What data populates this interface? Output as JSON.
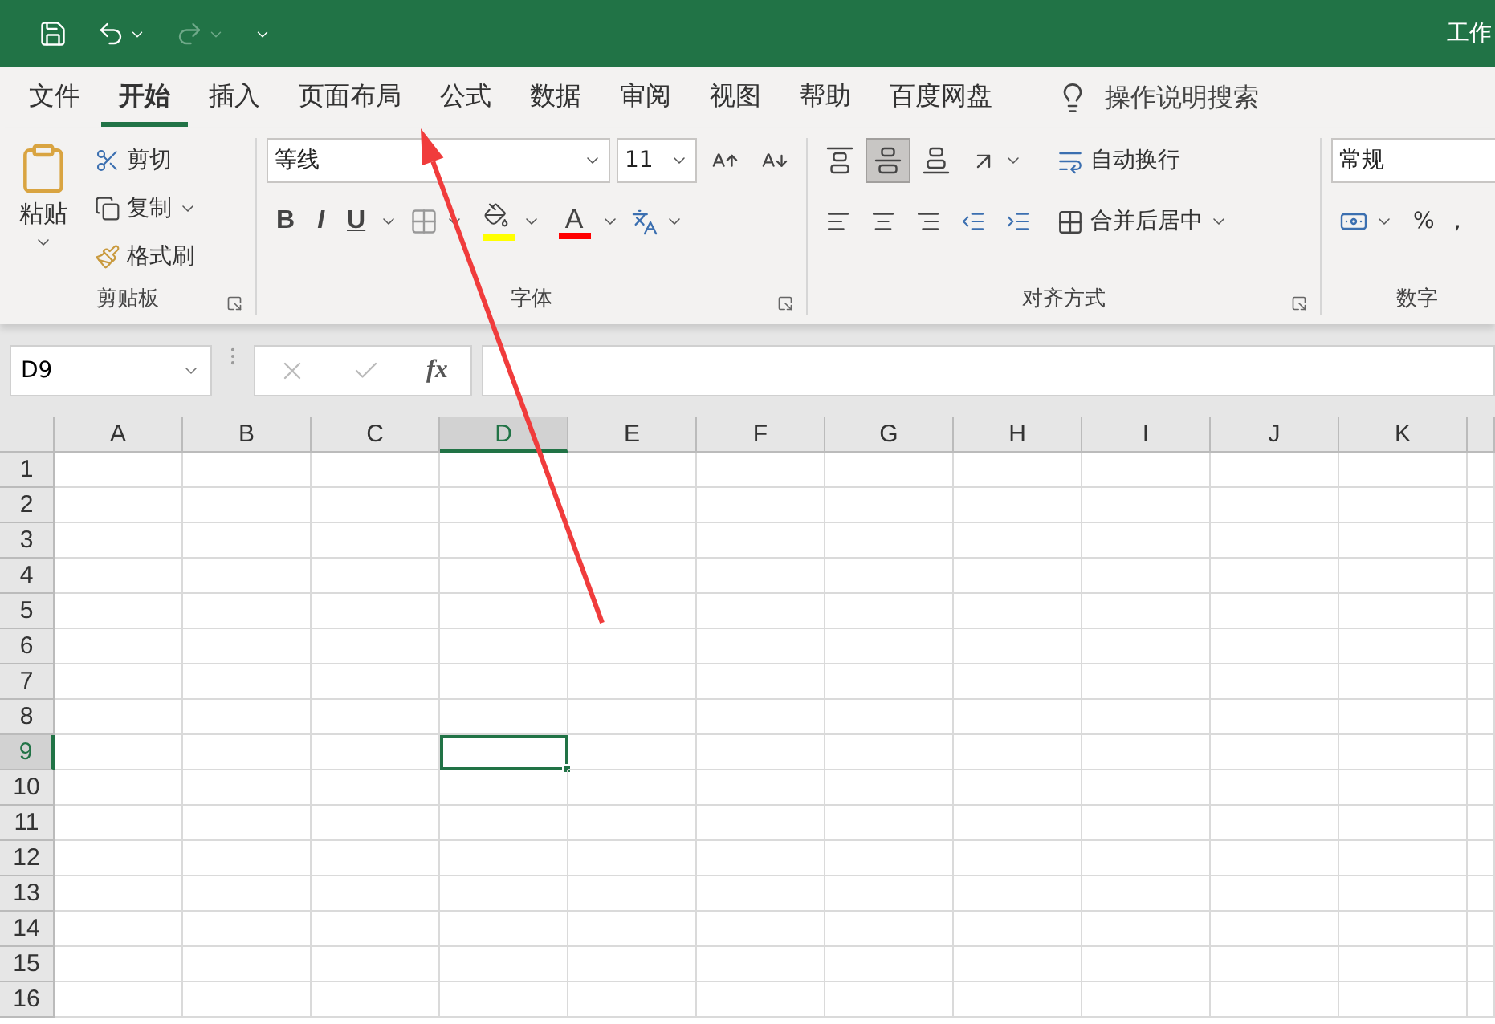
{
  "title_bar": {
    "title": "工作"
  },
  "tabs": [
    {
      "label": "文件",
      "selected": false
    },
    {
      "label": "开始",
      "selected": true
    },
    {
      "label": "插入",
      "selected": false
    },
    {
      "label": "页面布局",
      "selected": false
    },
    {
      "label": "公式",
      "selected": false
    },
    {
      "label": "数据",
      "selected": false
    },
    {
      "label": "审阅",
      "selected": false
    },
    {
      "label": "视图",
      "selected": false
    },
    {
      "label": "帮助",
      "selected": false
    },
    {
      "label": "百度网盘",
      "selected": false
    }
  ],
  "tell_me": {
    "label": "操作说明搜索"
  },
  "ribbon": {
    "clipboard": {
      "label": "剪贴板",
      "paste": "粘贴",
      "cut": "剪切",
      "copy": "复制",
      "format_painter": "格式刷"
    },
    "font": {
      "label": "字体",
      "font_name": "等线",
      "font_size": "11",
      "bold": "B",
      "italic": "I",
      "underline": "U",
      "font_color_glyph": "A"
    },
    "alignment": {
      "label": "对齐方式",
      "wrap_text": "自动换行",
      "merge_center": "合并后居中",
      "vertical": [
        {
          "selected": false
        },
        {
          "selected": true
        },
        {
          "selected": false
        }
      ]
    },
    "number": {
      "label": "数字",
      "format": "常规",
      "percent": "%",
      "comma": ","
    }
  },
  "formula_bar": {
    "name_box": "D9",
    "function_label": "fx"
  },
  "sheet": {
    "columns": [
      {
        "label": "A",
        "selected": false
      },
      {
        "label": "B",
        "selected": false
      },
      {
        "label": "C",
        "selected": false
      },
      {
        "label": "D",
        "selected": true
      },
      {
        "label": "E",
        "selected": false
      },
      {
        "label": "F",
        "selected": false
      },
      {
        "label": "G",
        "selected": false
      },
      {
        "label": "H",
        "selected": false
      },
      {
        "label": "I",
        "selected": false
      },
      {
        "label": "J",
        "selected": false
      },
      {
        "label": "K",
        "selected": false
      }
    ],
    "rows": [
      {
        "label": "1",
        "selected": false
      },
      {
        "label": "2",
        "selected": false
      },
      {
        "label": "3",
        "selected": false
      },
      {
        "label": "4",
        "selected": false
      },
      {
        "label": "5",
        "selected": false
      },
      {
        "label": "6",
        "selected": false
      },
      {
        "label": "7",
        "selected": false
      },
      {
        "label": "8",
        "selected": false
      },
      {
        "label": "9",
        "selected": true
      },
      {
        "label": "10",
        "selected": false
      },
      {
        "label": "11",
        "selected": false
      },
      {
        "label": "12",
        "selected": false
      },
      {
        "label": "13",
        "selected": false
      },
      {
        "label": "14",
        "selected": false
      },
      {
        "label": "15",
        "selected": false
      },
      {
        "label": "16",
        "selected": false
      }
    ]
  }
}
